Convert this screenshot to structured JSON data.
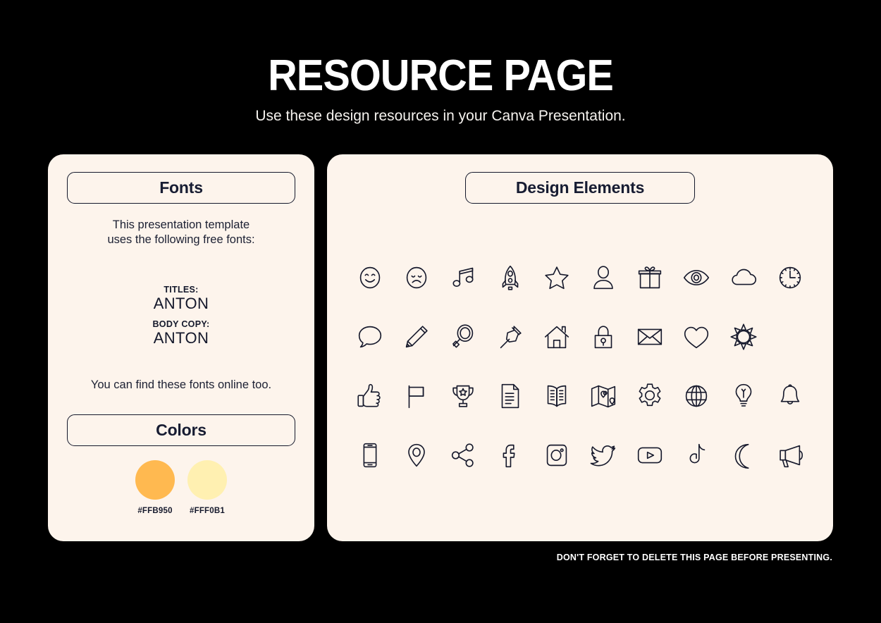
{
  "header": {
    "title": "RESOURCE PAGE",
    "subtitle": "Use these design resources in your Canva Presentation."
  },
  "fonts_card": {
    "pill_label": "Fonts",
    "intro_line1": "This presentation template",
    "intro_line2": "uses the following free fonts:",
    "titles_role": "TITLES:",
    "titles_font": "ANTON",
    "body_role": "BODY COPY:",
    "body_font": "ANTON",
    "outro": "You can find these fonts online too."
  },
  "colors_card": {
    "pill_label": "Colors",
    "swatches": [
      {
        "hex": "#FFB950",
        "label": "#FFB950"
      },
      {
        "hex": "#FFF0B1",
        "label": "#FFF0B1"
      }
    ]
  },
  "elements_card": {
    "pill_label": "Design Elements",
    "rows": [
      [
        {
          "icon": "smiley-face-icon"
        },
        {
          "icon": "sad-face-icon"
        },
        {
          "icon": "music-note-icon"
        },
        {
          "icon": "rocket-icon"
        },
        {
          "icon": "star-icon"
        },
        {
          "icon": "person-icon"
        },
        {
          "icon": "gift-icon"
        },
        {
          "icon": "eye-icon"
        },
        {
          "icon": "cloud-icon"
        },
        {
          "icon": "clock-icon"
        }
      ],
      [
        {
          "icon": "speech-bubble-icon"
        },
        {
          "icon": "pencil-icon"
        },
        {
          "icon": "magnifier-icon"
        },
        {
          "icon": "pushpin-icon"
        },
        {
          "icon": "house-icon"
        },
        {
          "icon": "lock-icon"
        },
        {
          "icon": "envelope-icon"
        },
        {
          "icon": "heart-icon"
        },
        {
          "icon": "sun-icon"
        }
      ],
      [
        {
          "icon": "thumbs-up-icon"
        },
        {
          "icon": "flag-icon"
        },
        {
          "icon": "trophy-icon"
        },
        {
          "icon": "document-icon"
        },
        {
          "icon": "open-book-icon"
        },
        {
          "icon": "map-icon"
        },
        {
          "icon": "gear-icon"
        },
        {
          "icon": "globe-icon"
        },
        {
          "icon": "lightbulb-icon"
        },
        {
          "icon": "bell-icon"
        }
      ],
      [
        {
          "icon": "phone-icon"
        },
        {
          "icon": "location-pin-icon"
        },
        {
          "icon": "share-icon"
        },
        {
          "icon": "facebook-icon"
        },
        {
          "icon": "instagram-icon"
        },
        {
          "icon": "twitter-icon"
        },
        {
          "icon": "youtube-icon"
        },
        {
          "icon": "tiktok-icon"
        },
        {
          "icon": "moon-icon"
        },
        {
          "icon": "megaphone-icon"
        }
      ]
    ]
  },
  "footer": {
    "note": "DON'T FORGET TO DELETE THIS PAGE BEFORE PRESENTING."
  },
  "theme": {
    "background": "#000000",
    "card_background": "#FDF4EC",
    "ink": "#14182B",
    "text_on_dark": "#FFFFFF"
  }
}
